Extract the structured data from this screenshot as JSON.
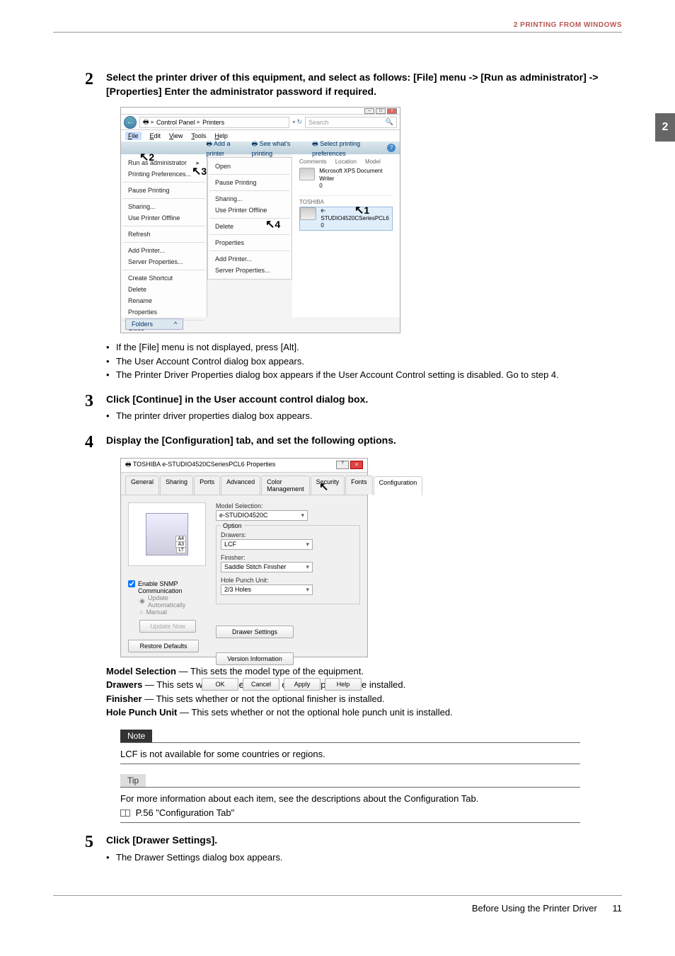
{
  "header": {
    "section": "2 PRINTING FROM WINDOWS"
  },
  "page_tab": "2",
  "steps": {
    "s2": {
      "num": "2",
      "title": "Select the printer driver of this equipment, and select as follows: [File] menu -> [Run as administrator] -> [Properties]  Enter the administrator password if required.",
      "bullets": [
        "If the [File] menu is not displayed, press [Alt].",
        "The User Account Control dialog box appears.",
        "The Printer Driver Properties dialog box appears if the User Account Control setting is disabled. Go to step 4."
      ]
    },
    "s3": {
      "num": "3",
      "title": "Click [Continue] in the User account control dialog box.",
      "bullets": [
        "The printer driver properties dialog box appears."
      ]
    },
    "s4": {
      "num": "4",
      "title": "Display the [Configuration] tab, and set the following options."
    },
    "s5": {
      "num": "5",
      "title": "Click [Drawer Settings].",
      "bullets": [
        "The Drawer Settings dialog box appears."
      ]
    }
  },
  "screenshot1": {
    "breadcrumb": {
      "part1": "Control Panel",
      "part2": "Printers"
    },
    "search_placeholder": "Search",
    "menubar": [
      "File",
      "Edit",
      "View",
      "Tools",
      "Help"
    ],
    "toolbar": {
      "add": "Add a printer",
      "see": "See what's printing",
      "select": "Select printing preferences"
    },
    "left_menu": {
      "run_as_admin": "Run as administrator",
      "printing_prefs": "Printing Preferences...",
      "pause": "Pause Printing",
      "sharing": "Sharing...",
      "use_offline": "Use Printer Offline",
      "refresh": "Refresh",
      "add_printer": "Add Printer...",
      "server_props": "Server Properties...",
      "create_shortcut": "Create Shortcut",
      "delete": "Delete",
      "rename": "Rename",
      "properties": "Properties",
      "close": "Close"
    },
    "sub_menu": {
      "open": "Open",
      "pause": "Pause Printing",
      "sharing": "Sharing...",
      "use_offline": "Use Printer Offline",
      "delete": "Delete",
      "properties": "Properties",
      "add_printer": "Add Printer...",
      "server_props": "Server Properties..."
    },
    "right_panel": {
      "cols": {
        "comments": "Comments",
        "location": "Location",
        "model": "Model"
      },
      "p1_name": "Microsoft XPS Document Writer",
      "p1_status": "0",
      "p2_brand": "TOSHIBA",
      "p2_name": "e-STUDIO4520CSeriesPCL6",
      "p2_status": "0"
    },
    "footer": "Folders",
    "anno": {
      "n1": "1",
      "n2": "2",
      "n3": "3",
      "n4": "4"
    }
  },
  "screenshot2": {
    "title": "TOSHIBA e-STUDIO4520CSeriesPCL6 Properties",
    "tabs": [
      "General",
      "Sharing",
      "Ports",
      "Advanced",
      "Color Management",
      "Security",
      "Fonts",
      "Configuration"
    ],
    "model_selection_label": "Model Selection:",
    "model_selection_value": "e-STUDIO4520C",
    "option_group": "Option",
    "drawers_label": "Drawers:",
    "drawers_value": "LCF",
    "finisher_label": "Finisher:",
    "finisher_value": "Saddle Stitch Finisher",
    "hole_punch_label": "Hole Punch Unit:",
    "hole_punch_value": "2/3 Holes",
    "enable_snmp": "Enable SNMP Communication",
    "update_auto": "Update Automatically",
    "manual": "Manual",
    "update_now": "Update Now",
    "restore_defaults": "Restore Defaults",
    "drawer_settings": "Drawer Settings",
    "version_info": "Version Information",
    "drawer_labels": {
      "a4": "A4",
      "a3": "A3",
      "lt": "LT"
    },
    "buttons": {
      "ok": "OK",
      "cancel": "Cancel",
      "apply": "Apply",
      "help": "Help"
    }
  },
  "descriptions": {
    "model": {
      "term": "Model Selection",
      "text": " — This sets the model type of the equipment."
    },
    "drawers": {
      "term": "Drawers",
      "text": " — This sets whether the drawers or LCF (optional) are installed."
    },
    "finisher": {
      "term": "Finisher",
      "text": " — This sets whether or not the optional finisher  is installed."
    },
    "hole": {
      "term": "Hole Punch Unit",
      "text": " — This sets whether or not the optional hole punch unit is installed."
    }
  },
  "note": {
    "label": "Note",
    "text": "LCF is not available for some countries or regions."
  },
  "tip": {
    "label": "Tip",
    "text": "For more information about each item, see the descriptions about the Configuration Tab.",
    "ref": " P.56 \"Configuration Tab\""
  },
  "footer": {
    "text": "Before Using the Printer Driver",
    "page": "11"
  }
}
